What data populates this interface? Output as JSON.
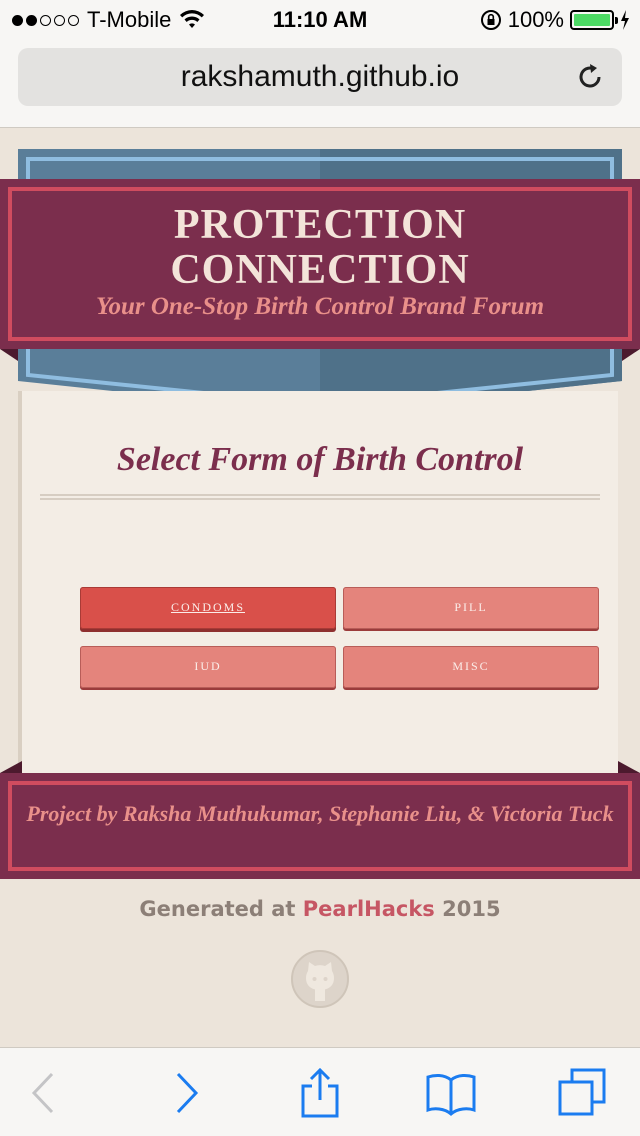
{
  "status_bar": {
    "carrier": "T-Mobile",
    "time": "11:10 AM",
    "battery": "100%",
    "signal_bars_filled": 2,
    "signal_bars_total": 5
  },
  "browser": {
    "url": "rakshamuth.github.io"
  },
  "site": {
    "title_line1": "PROTECTION",
    "title_line2": "CONNECTION",
    "subtitle": "Your One-Stop Birth Control Brand Forum",
    "section_title": "Select Form of Birth Control",
    "buttons": [
      {
        "label": "CONDOMS",
        "active": true
      },
      {
        "label": "PILL",
        "active": false
      },
      {
        "label": "IUD",
        "active": false
      },
      {
        "label": "MISC",
        "active": false
      }
    ],
    "credits": "Project by Raksha Muthukumar, Stephanie Liu, & Victoria Tuck",
    "generated_prefix": "Generated at",
    "generated_brand": "PearlHacks",
    "generated_year": "2015"
  },
  "colors": {
    "band": "#7b2e4d",
    "accent_pink": "#e9908a",
    "button": "#e4847c",
    "button_active": "#d9504a",
    "blue_ribbon": "#5a7e99",
    "background": "#ece4da"
  }
}
